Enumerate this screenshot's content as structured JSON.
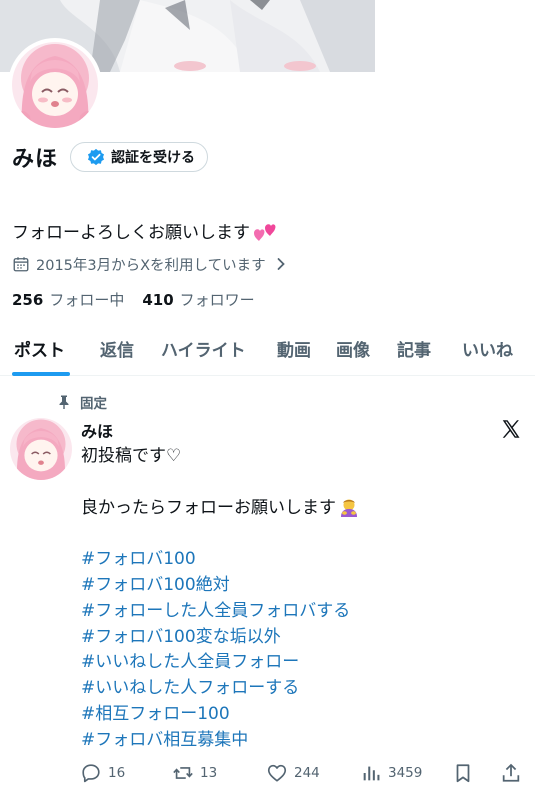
{
  "profile": {
    "display_name": "みほ",
    "verify_label": "認証を受ける",
    "bio": "フォローよろしくお願いします",
    "joined": "2015年3月からXを利用しています",
    "following_count": "256",
    "following_label": "フォロー中",
    "followers_count": "410",
    "followers_label": "フォロワー"
  },
  "tabs": [
    {
      "label": "ポスト"
    },
    {
      "label": "返信"
    },
    {
      "label": "ハイライト"
    },
    {
      "label": "動画"
    },
    {
      "label": "画像"
    },
    {
      "label": "記事"
    },
    {
      "label": "いいね"
    }
  ],
  "post": {
    "pinned_label": "固定",
    "author": "みほ",
    "lines": [
      "初投稿です♡",
      "",
      "良かったらフォローお願いします",
      "",
      "#フォロバ100",
      "#フォロバ100絶対",
      "#フォローした人全員フォロバする",
      "#フォロバ100変な垢以外",
      "#いいねした人全員フォロー",
      "#いいねした人フォローする",
      "#相互フォロー100",
      "#フォロバ相互募集中"
    ],
    "replies": "16",
    "reposts": "13",
    "likes": "244",
    "views": "3459"
  },
  "colors": {
    "accent": "#1d9bf0",
    "hashtag": "#1d76ba",
    "muted": "#536471"
  },
  "icons": [
    "calendar-icon",
    "chevron-right-icon",
    "verified-badge-icon",
    "pin-icon",
    "x-logo-icon",
    "reply-icon",
    "repost-icon",
    "like-icon",
    "views-icon",
    "bookmark-icon",
    "share-icon"
  ]
}
